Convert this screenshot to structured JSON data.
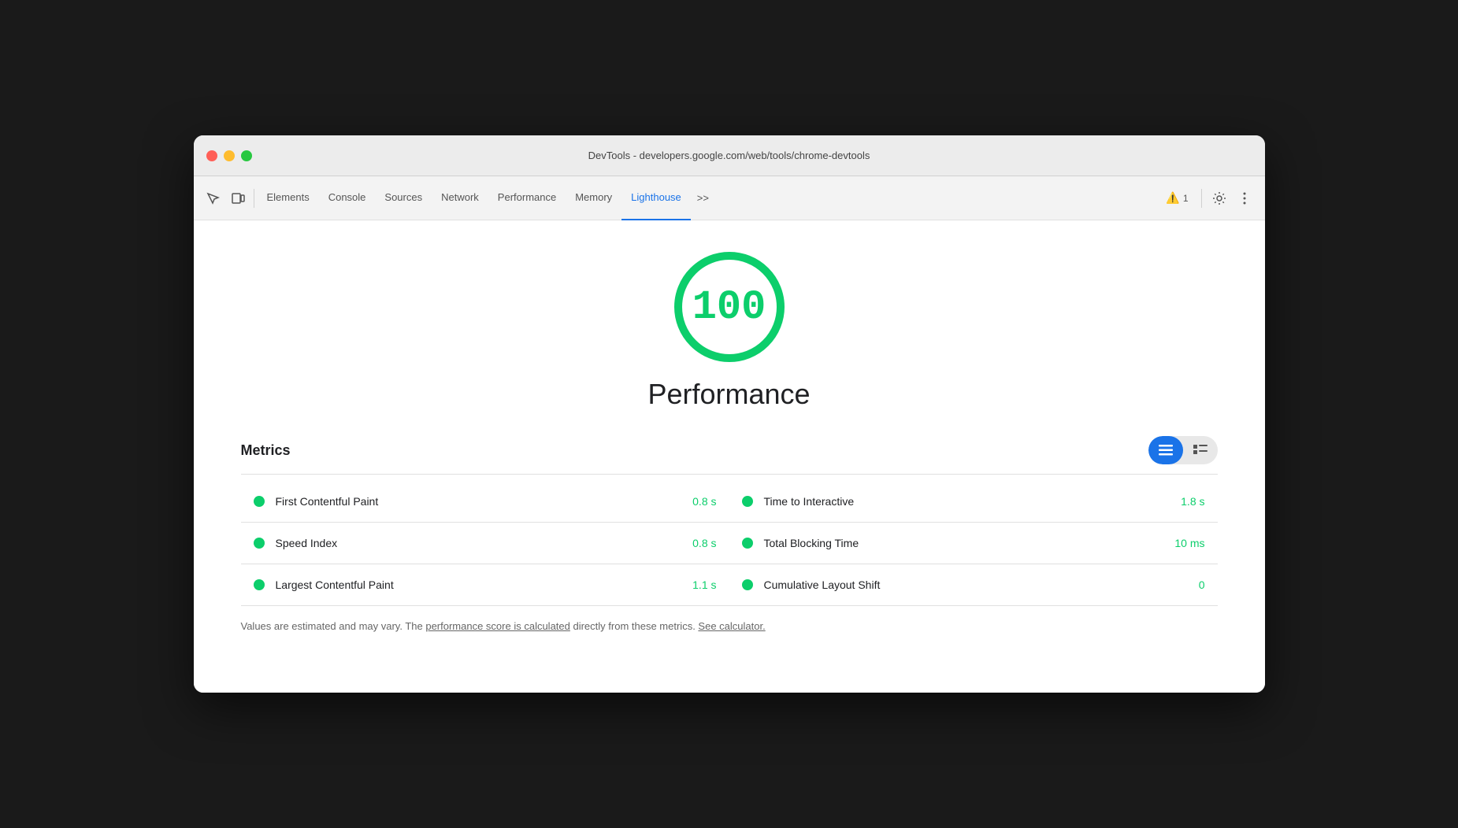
{
  "window": {
    "title": "DevTools - developers.google.com/web/tools/chrome-devtools"
  },
  "tabs": {
    "items": [
      {
        "label": "Elements",
        "active": false
      },
      {
        "label": "Console",
        "active": false
      },
      {
        "label": "Sources",
        "active": false
      },
      {
        "label": "Network",
        "active": false
      },
      {
        "label": "Performance",
        "active": false
      },
      {
        "label": "Memory",
        "active": false
      },
      {
        "label": "Lighthouse",
        "active": true
      }
    ],
    "more_label": ">>",
    "warning_count": "1"
  },
  "score": {
    "value": "100",
    "label": "Performance"
  },
  "metrics": {
    "title": "Metrics",
    "rows": [
      {
        "name": "First Contentful Paint",
        "value": "0.8 s",
        "col": 0
      },
      {
        "name": "Time to Interactive",
        "value": "1.8 s",
        "col": 1
      },
      {
        "name": "Speed Index",
        "value": "0.8 s",
        "col": 0
      },
      {
        "name": "Total Blocking Time",
        "value": "10 ms",
        "col": 1
      },
      {
        "name": "Largest Contentful Paint",
        "value": "1.1 s",
        "col": 0
      },
      {
        "name": "Cumulative Layout Shift",
        "value": "0",
        "col": 1
      }
    ],
    "footer": "Values are estimated and may vary. The ",
    "footer_link1": "performance score is calculated",
    "footer_mid": " directly from these metrics. ",
    "footer_link2": "See calculator.",
    "view_toggle": {
      "grid_label": "☰",
      "list_label": "≡"
    }
  }
}
